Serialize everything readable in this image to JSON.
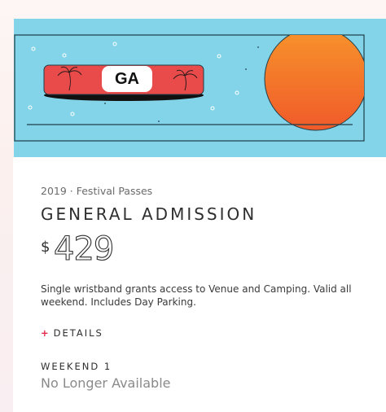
{
  "banner": {
    "wristband_label": "GA",
    "colors": {
      "sky": "#83d4e8",
      "band": "#e94b4b",
      "sun_top": "#f7942b",
      "sun_bottom": "#f05a2a"
    },
    "icons": [
      "palm-tree-icon",
      "palm-tree-icon",
      "sun-icon"
    ]
  },
  "ticket": {
    "meta": "2019 · Festival Passes",
    "title": "GENERAL ADMISSION",
    "currency": "$",
    "price": "429",
    "description": "Single wristband grants access to Venue and Camping. Valid all weekend. Includes Day Parking.",
    "details_symbol": "+",
    "details_label": "DETAILS",
    "weekend_label": "WEEKEND 1",
    "availability": "No Longer Available"
  },
  "accent_color": "#e02b4b"
}
